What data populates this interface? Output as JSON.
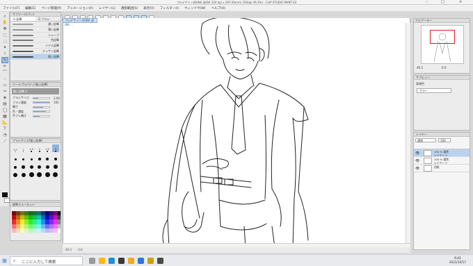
{
  "title": "プロデザイン(BUNA 改(B4 350 dpi x 297.00mm) 350dpi 49.3%) - CLIP STUDIO PAINT EX",
  "menu": [
    "ファイル(F)",
    "編集(E)",
    "ページ管理(P)",
    "アニメーション(A)",
    "レイヤー(L)",
    "選択範囲(S)",
    "表示(V)",
    "フィルター(I)",
    "ウィンドウ(W)",
    "ヘルプ(H)"
  ],
  "doc_tab": "プロデザイン BUNA 改(B4 ...",
  "brush_panel": {
    "title": "サブツール[ペン]",
    "tabs": [
      "G 鉛筆",
      "G ブラシ"
    ],
    "items": [
      "濃い鉛筆",
      "薄い鉛筆",
      "シャープ",
      "色鉛筆",
      "リアル鉛筆",
      "デッサン鉛筆",
      "粗い鉛筆"
    ],
    "selected_index": 6
  },
  "tool_props": {
    "title": "ツールプロパティ[粗い鉛筆]",
    "preset": "粗い鉛筆 2",
    "rows": [
      {
        "label": "ブラシサイズ",
        "value": "3.00",
        "fill": 0.3
      },
      {
        "label": "ブラシ濃度",
        "value": "100",
        "fill": 1.0
      },
      {
        "label": "硬さ",
        "value": "",
        "fill": 0.6
      },
      {
        "label": "色・濃度",
        "value": "",
        "fill": 0.8
      },
      {
        "label": "手ブレ補正",
        "value": "",
        "fill": 0.4
      }
    ]
  },
  "brush_size": {
    "title": "ブラシサイズ[粗い鉛筆]",
    "sizes": [
      "0.7",
      "1",
      "1.5",
      "2",
      "2.5",
      "3",
      "4",
      "5",
      "6",
      "7",
      "8",
      "10",
      "12",
      "15",
      "17",
      "20",
      "25",
      "30",
      "40",
      "50",
      "60",
      "70",
      "80",
      "100"
    ],
    "selected": "3"
  },
  "color_panel": {
    "title": "カラーセット",
    "preset": "標準カラーセット"
  },
  "navigator": {
    "zoom": "49.3",
    "angle": "0.0"
  },
  "material_panel": {
    "title": "サブビュー",
    "label": "表現色",
    "value": "カラー"
  },
  "layer_panel": {
    "title": "レイヤー",
    "blend": "通常",
    "opacity": "100",
    "layers": [
      {
        "name": "100 % 通常",
        "sub": "レイヤー 3",
        "selected": true
      },
      {
        "name": "100 % 通常",
        "sub": "レイヤー 2",
        "selected": false
      },
      {
        "name": "用紙",
        "sub": "",
        "selected": false
      }
    ]
  },
  "status": {
    "zoom": "49.3",
    "angle": "0.0"
  },
  "taskbar": {
    "search_placeholder": "ここに入力して検索",
    "time": "6:42",
    "date": "2021/10/17"
  },
  "colors": {
    "accent": "#5b8dc2",
    "selected_bg": "#b9d3ee",
    "nav_frame": "#e0161f"
  }
}
